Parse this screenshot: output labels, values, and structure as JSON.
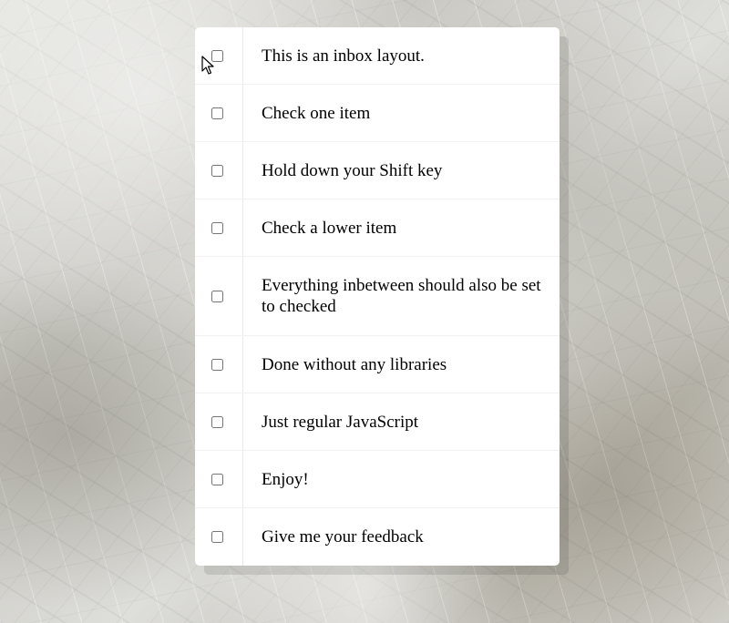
{
  "inbox": {
    "items": [
      {
        "label": "This is an inbox layout.",
        "checked": false
      },
      {
        "label": "Check one item",
        "checked": false
      },
      {
        "label": "Hold down your Shift key",
        "checked": false
      },
      {
        "label": "Check a lower item",
        "checked": false
      },
      {
        "label": "Everything inbetween should also be set to checked",
        "checked": false
      },
      {
        "label": "Done without any libraries",
        "checked": false
      },
      {
        "label": "Just regular JavaScript",
        "checked": false
      },
      {
        "label": "Enjoy!",
        "checked": false
      },
      {
        "label": "Give me your feedback",
        "checked": false
      }
    ]
  },
  "icons": {
    "cursor": "mouse-pointer-icon"
  }
}
